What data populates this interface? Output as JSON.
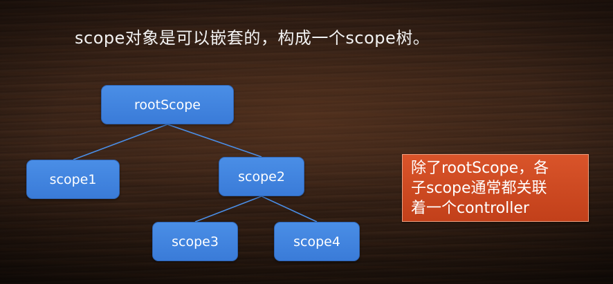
{
  "slide": {
    "title": "scope对象是可以嵌套的，构成一个scope树。",
    "tree": {
      "root": "rootScope",
      "scope1": "scope1",
      "scope2": "scope2",
      "scope3": "scope3",
      "scope4": "scope4"
    },
    "note": "除了rootScope，各\n子scope通常都关联\n着一个controller"
  },
  "colors": {
    "node_fill": "#3f82dc",
    "connector": "#4a8ee6",
    "note_fill": "#d04a22",
    "background": "#3a2418"
  }
}
